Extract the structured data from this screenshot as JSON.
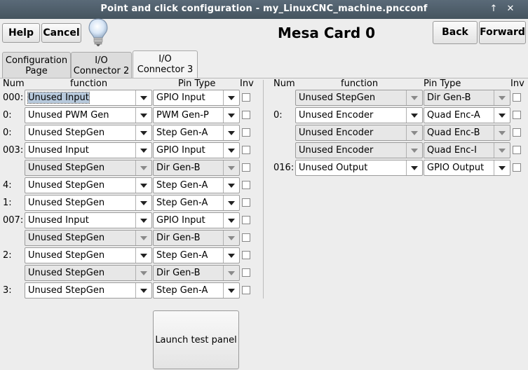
{
  "window": {
    "title": "Point and click configuration - my_LinuxCNC_machine.pncconf",
    "controls": [
      "↑",
      "✕"
    ]
  },
  "header": {
    "help_label": "Help",
    "cancel_label": "Cancel",
    "page_title": "Mesa Card 0",
    "back_label": "Back",
    "forward_label": "Forward"
  },
  "tabs": [
    {
      "label1": "Configuration",
      "label2": "Page"
    },
    {
      "label1": "I/O",
      "label2": "Connector 2"
    },
    {
      "label1": "I/O",
      "label2": "Connector 3"
    }
  ],
  "columns": {
    "num": "Num",
    "function": "function",
    "pin_type": "Pin Type",
    "inv": "Inv"
  },
  "left_rows": [
    {
      "num": "000:",
      "function": "Unused Input",
      "pin_type": "GPIO Input"
    },
    {
      "num": "0:",
      "function": "Unused PWM Gen",
      "pin_type": "PWM Gen-P"
    },
    {
      "num": "0:",
      "function": "Unused StepGen",
      "pin_type": "Step Gen-A"
    },
    {
      "num": "003:",
      "function": "Unused Input",
      "pin_type": "GPIO Input"
    },
    {
      "num": "",
      "function": "Unused StepGen",
      "pin_type": "Dir Gen-B"
    },
    {
      "num": "4:",
      "function": "Unused StepGen",
      "pin_type": "Step Gen-A"
    },
    {
      "num": "1:",
      "function": "Unused StepGen",
      "pin_type": "Step Gen-A"
    },
    {
      "num": "007:",
      "function": "Unused Input",
      "pin_type": "GPIO Input"
    },
    {
      "num": "",
      "function": "Unused StepGen",
      "pin_type": "Dir Gen-B"
    },
    {
      "num": "2:",
      "function": "Unused StepGen",
      "pin_type": "Step Gen-A"
    },
    {
      "num": "",
      "function": "Unused StepGen",
      "pin_type": "Dir Gen-B"
    },
    {
      "num": "3:",
      "function": "Unused StepGen",
      "pin_type": "Step Gen-A"
    }
  ],
  "right_rows": [
    {
      "num": "",
      "function": "Unused StepGen",
      "pin_type": "Dir Gen-B"
    },
    {
      "num": "0:",
      "function": "Unused Encoder",
      "pin_type": "Quad Enc-A"
    },
    {
      "num": "",
      "function": "Unused Encoder",
      "pin_type": "Quad Enc-B"
    },
    {
      "num": "",
      "function": "Unused Encoder",
      "pin_type": "Quad Enc-I"
    },
    {
      "num": "016:",
      "function": "Unused Output",
      "pin_type": "GPIO Output"
    }
  ],
  "test_panel_label": "Launch test panel"
}
